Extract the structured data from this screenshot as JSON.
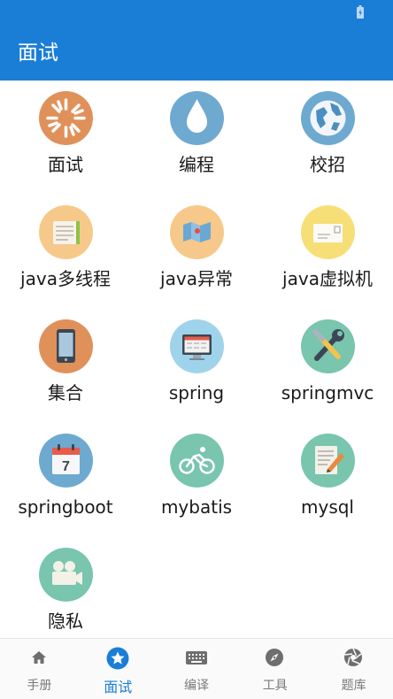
{
  "header": {
    "title": "面试"
  },
  "categories": [
    {
      "label": "面试",
      "icon": "sunburst-icon",
      "color": "#e0915a"
    },
    {
      "label": "编程",
      "icon": "water-drop-icon",
      "color": "#6ea9d0"
    },
    {
      "label": "校招",
      "icon": "globe-icon",
      "color": "#6ea9d0"
    },
    {
      "label": "java多线程",
      "icon": "notebook-icon",
      "color": "#f6c98a"
    },
    {
      "label": "java异常",
      "icon": "map-icon",
      "color": "#f6c98a"
    },
    {
      "label": "java虚拟机",
      "icon": "envelope-icon",
      "color": "#f7df78"
    },
    {
      "label": "集合",
      "icon": "phone-icon",
      "color": "#e0915a"
    },
    {
      "label": "spring",
      "icon": "monitor-icon",
      "color": "#9fd3ec"
    },
    {
      "label": "springmvc",
      "icon": "tools-icon",
      "color": "#79c5ae"
    },
    {
      "label": "springboot",
      "icon": "calendar-icon",
      "color": "#6ea9d0"
    },
    {
      "label": "mybatis",
      "icon": "bicycle-icon",
      "color": "#79c5ae"
    },
    {
      "label": "mysql",
      "icon": "document-edit-icon",
      "color": "#79c5ae"
    },
    {
      "label": "隐私",
      "icon": "video-camera-icon",
      "color": "#79c5ae"
    }
  ],
  "calendar_day": "7",
  "bottom_nav": [
    {
      "label": "手册",
      "icon": "home-icon",
      "active": false
    },
    {
      "label": "面试",
      "icon": "star-icon",
      "active": true
    },
    {
      "label": "编译",
      "icon": "keyboard-icon",
      "active": false
    },
    {
      "label": "工具",
      "icon": "compass-icon",
      "active": false
    },
    {
      "label": "题库",
      "icon": "aperture-icon",
      "active": false
    }
  ],
  "colors": {
    "primary": "#1a7ed6",
    "nav_inactive": "#7a7a7a"
  }
}
